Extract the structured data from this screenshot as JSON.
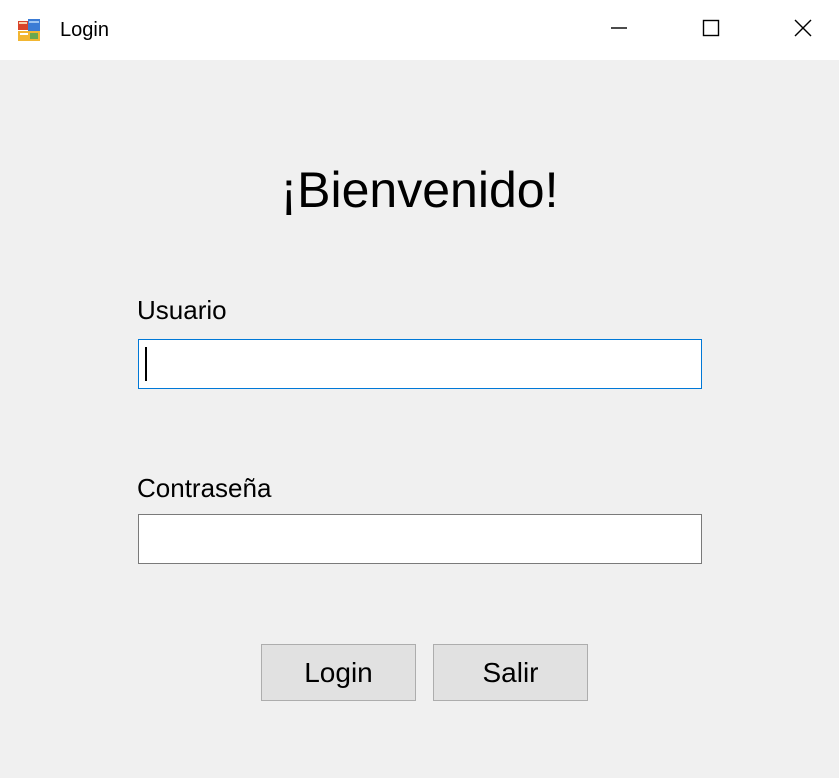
{
  "window": {
    "title": "Login",
    "controls": {
      "minimize_icon": "minimize-icon",
      "maximize_icon": "maximize-icon",
      "close_icon": "close-icon"
    }
  },
  "form": {
    "heading": "¡Bienvenido!",
    "username_label": "Usuario",
    "username_value": "",
    "password_label": "Contraseña",
    "password_value": "",
    "login_button": "Login",
    "exit_button": "Salir"
  },
  "colors": {
    "background": "#f0f0f0",
    "titlebar": "#ffffff",
    "focus_border": "#0078d7",
    "button_face": "#e1e1e1"
  }
}
